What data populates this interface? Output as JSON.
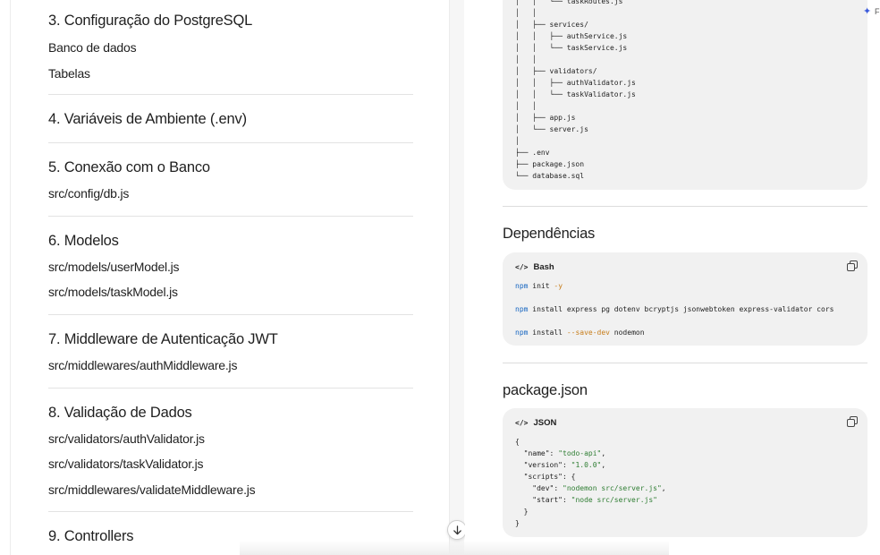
{
  "left": {
    "sections": [
      {
        "title": "3. Configuração do PostgreSQL",
        "items": [
          "Banco de dados",
          "Tabelas"
        ]
      },
      {
        "title": "4. Variáveis de Ambiente (.env)",
        "items": []
      },
      {
        "title": "5. Conexão com o Banco",
        "items": [
          "src/config/db.js"
        ]
      },
      {
        "title": "6. Modelos",
        "items": [
          "src/models/userModel.js",
          "src/models/taskModel.js"
        ]
      },
      {
        "title": "7. Middleware de Autenticação JWT",
        "items": [
          "src/middlewares/authMiddleware.js"
        ]
      },
      {
        "title": "8. Validação de Dados",
        "items": [
          "src/validators/authValidator.js",
          "src/validators/taskValidator.js",
          "src/middlewares/validateMiddleware.js"
        ]
      },
      {
        "title": "9. Controllers",
        "items": []
      }
    ]
  },
  "tree": {
    "lines": [
      "│   │   └── taskRoutes.js",
      "│   │",
      "│   ├── services/",
      "│   │   ├── authService.js",
      "│   │   └── taskService.js",
      "│   │",
      "│   ├── validators/",
      "│   │   ├── authValidator.js",
      "│   │   └── taskValidator.js",
      "│   │",
      "│   ├── app.js",
      "│   └── server.js",
      "│",
      "├── .env",
      "├── package.json",
      "└── database.sql"
    ]
  },
  "dependencies": {
    "heading": "Dependências",
    "lang": "Bash",
    "commands": [
      {
        "cmd": "npm",
        "args_pre": " install ",
        "flag": "",
        "args": "init ",
        "flag2": "-y"
      },
      {
        "cmd": "npm",
        "args_pre": " install express pg dotenv bcryptjs jsonwebtoken express-validator cors",
        "flag": "",
        "args": "",
        "flag2": ""
      },
      {
        "cmd": "npm",
        "args_pre": " install ",
        "flag": "--save-dev",
        "args": " nodemon",
        "flag2": ""
      }
    ],
    "line1": "init ",
    "line1_flag": "-y",
    "line2": "install express pg dotenv bcryptjs jsonwebtoken express-validator cors",
    "line3": "install ",
    "line3_flag": "--save-dev",
    "line3_tail": " nodemon",
    "npm": "npm"
  },
  "package": {
    "heading": "package.json",
    "lang": "JSON",
    "open": "{",
    "name_key": "\"name\"",
    "name_val": "\"todo-api\"",
    "version_key": "\"version\"",
    "version_val": "\"1.0.0\"",
    "scripts_key": "\"scripts\"",
    "dev_key": "\"dev\"",
    "dev_val": "\"nodemon src/server.js\"",
    "start_key": "\"start\"",
    "start_val": "\"node src/server.js\"",
    "inner_close": "}",
    "close": "}"
  },
  "icons": {
    "scroll": "arrow-down-icon",
    "copy": "copy-icon",
    "code": "code-icon",
    "sparkle": "sparkle-icon"
  },
  "colors": {
    "code_bg": "#f1f1f1",
    "command": "#1565c0",
    "flag": "#c77d1a",
    "string": "#2e7d32",
    "sparkle": "#3b5bdb"
  },
  "edge_label": "F"
}
